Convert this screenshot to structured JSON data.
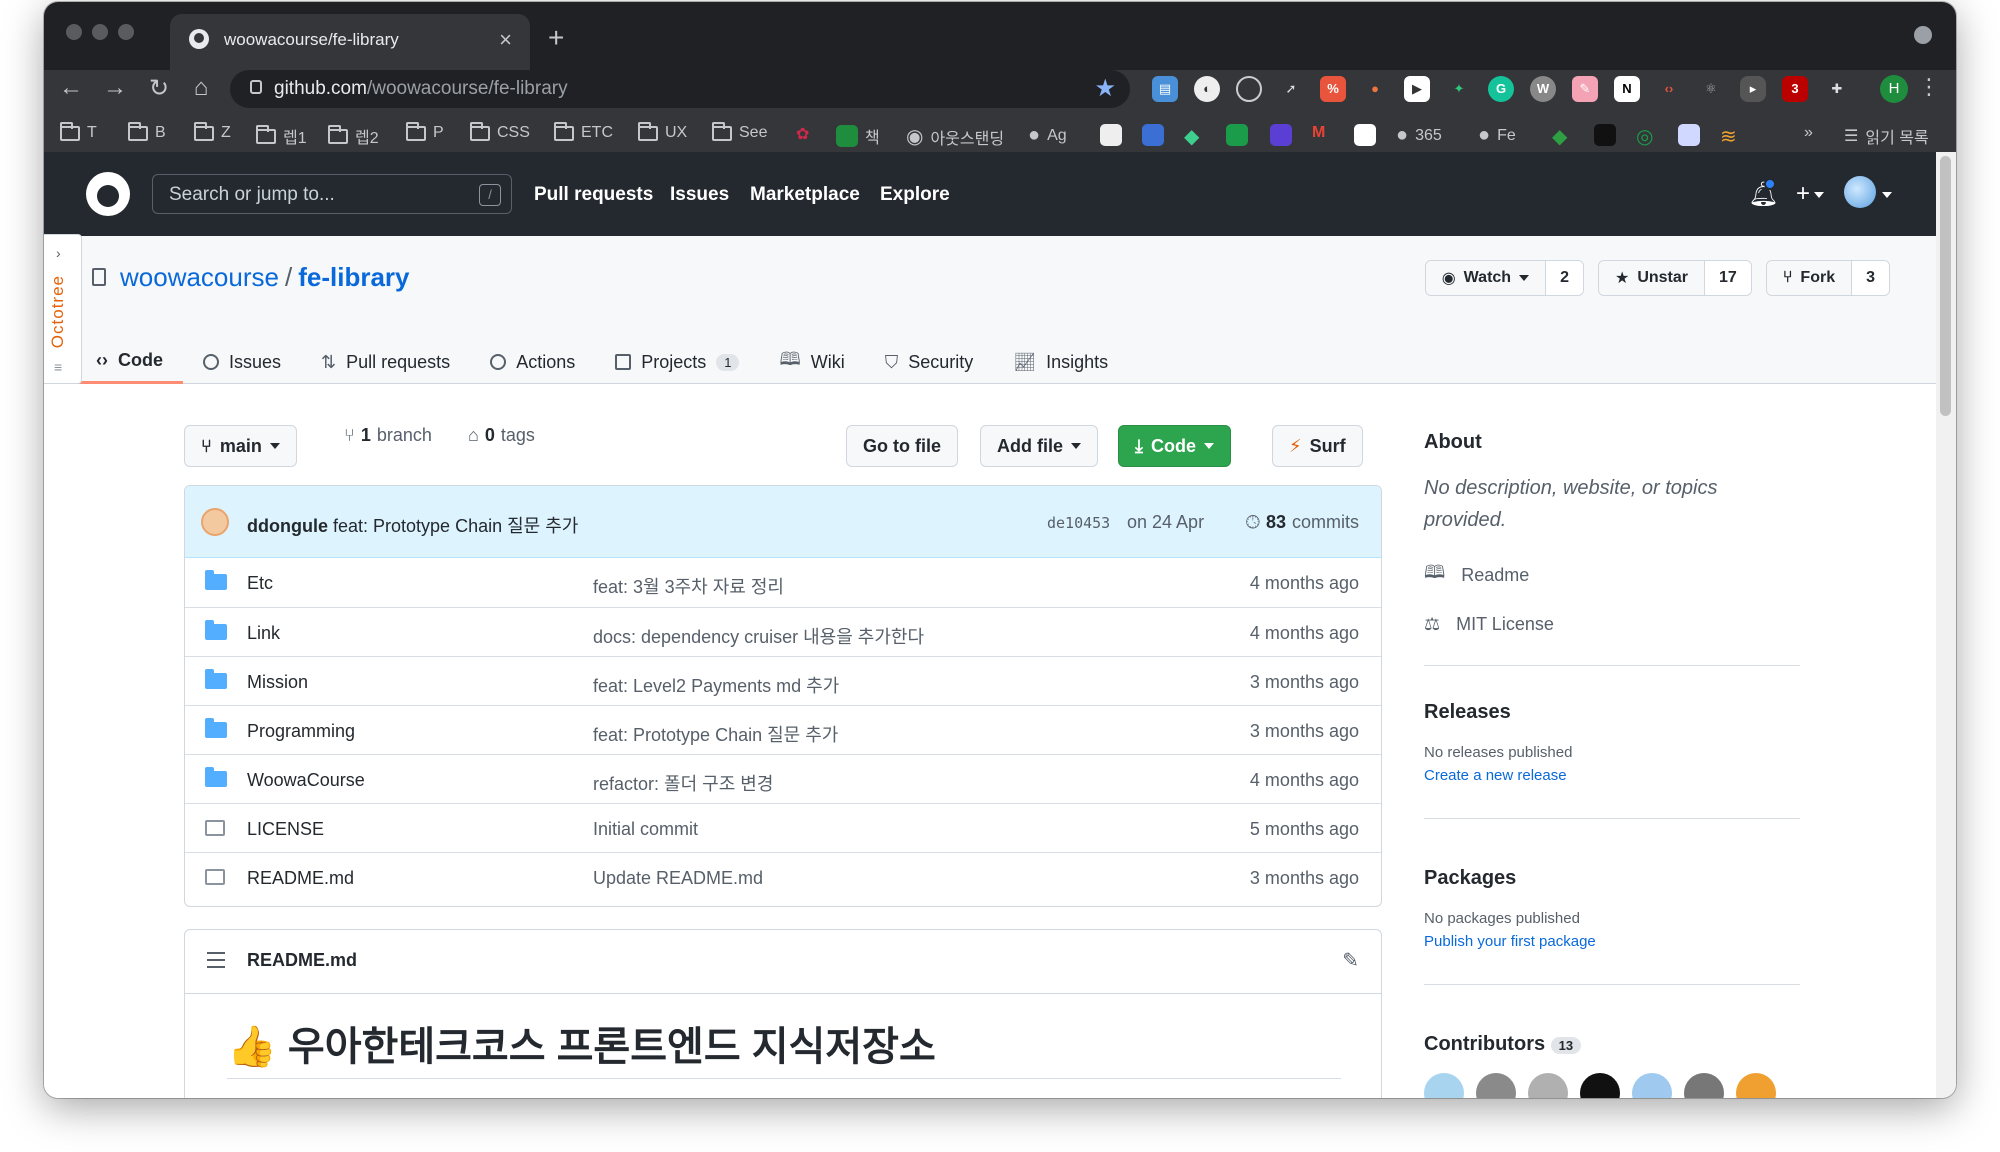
{
  "browser": {
    "tab_title": "woowacourse/fe-library",
    "url_host": "github.com",
    "url_path": "/woowacourse/fe-library",
    "bookmarks": [
      "T",
      "B",
      "Z",
      "렙1",
      "렙2",
      "P",
      "CSS",
      "ETC",
      "UX",
      "See",
      "책",
      "아웃스탠딩",
      "Ag",
      "365",
      "Fe",
      "»",
      "읽기 목록"
    ],
    "profile_initial": "H",
    "extension_badge": "3"
  },
  "github": {
    "search_placeholder": "Search or jump to...",
    "search_shortcut": "/",
    "nav": [
      "Pull requests",
      "Issues",
      "Marketplace",
      "Explore"
    ]
  },
  "octotree_label": "Octotree",
  "repo": {
    "owner": "woowacourse",
    "name": "fe-library",
    "watch_label": "Watch",
    "watch_count": "2",
    "star_label": "Unstar",
    "star_count": "17",
    "fork_label": "Fork",
    "fork_count": "3",
    "tabs": [
      {
        "label": "Code",
        "icon": "code-icon"
      },
      {
        "label": "Issues",
        "icon": "issue-icon"
      },
      {
        "label": "Pull requests",
        "icon": "pull-request-icon"
      },
      {
        "label": "Actions",
        "icon": "play-icon"
      },
      {
        "label": "Projects",
        "icon": "project-icon",
        "counter": "1"
      },
      {
        "label": "Wiki",
        "icon": "book-icon"
      },
      {
        "label": "Security",
        "icon": "shield-icon"
      },
      {
        "label": "Insights",
        "icon": "graph-icon"
      }
    ]
  },
  "toolbar": {
    "branch": "main",
    "branch_count": "1",
    "branch_label": "branch",
    "tag_count": "0",
    "tag_label": "tags",
    "go_to_file": "Go to file",
    "add_file": "Add file",
    "code": "Code",
    "surf": "Surf"
  },
  "commit": {
    "author": "ddongule",
    "message": "feat: Prototype Chain 질문 추가",
    "sha": "de10453",
    "date": "on 24 Apr",
    "count": "83",
    "count_label": "commits"
  },
  "files": [
    {
      "name": "Etc",
      "type": "dir",
      "message": "feat: 3월 3주차 자료 정리",
      "age": "4 months ago"
    },
    {
      "name": "Link",
      "type": "dir",
      "message": "docs: dependency cruiser 내용을 추가한다",
      "age": "4 months ago"
    },
    {
      "name": "Mission",
      "type": "dir",
      "message": "feat: Level2 Payments md 추가",
      "age": "3 months ago"
    },
    {
      "name": "Programming",
      "type": "dir",
      "message": "feat: Prototype Chain 질문 추가",
      "age": "3 months ago"
    },
    {
      "name": "WoowaCourse",
      "type": "dir",
      "message": "refactor: 폴더 구조 변경",
      "age": "4 months ago"
    },
    {
      "name": "LICENSE",
      "type": "file",
      "message": "Initial commit",
      "age": "5 months ago"
    },
    {
      "name": "README.md",
      "type": "file",
      "message": "Update README.md",
      "age": "3 months ago"
    }
  ],
  "readme": {
    "filename": "README.md",
    "heading": "👍 우아한테크코스 프론트엔드 지식저장소"
  },
  "about": {
    "title": "About",
    "description": "No description, website, or topics provided.",
    "readme_link": "Readme",
    "license_link": "MIT License"
  },
  "releases": {
    "title": "Releases",
    "status": "No releases published",
    "action": "Create a new release"
  },
  "packages": {
    "title": "Packages",
    "status": "No packages published",
    "action": "Publish your first package"
  },
  "contributors": {
    "title": "Contributors",
    "count": "13"
  },
  "colors": {
    "github_header": "#24292f",
    "link_blue": "#0969da",
    "code_button_green": "#2da44e",
    "commit_bar_blue": "#ddf4ff",
    "selected_tab_underline": "#fd8c73"
  }
}
